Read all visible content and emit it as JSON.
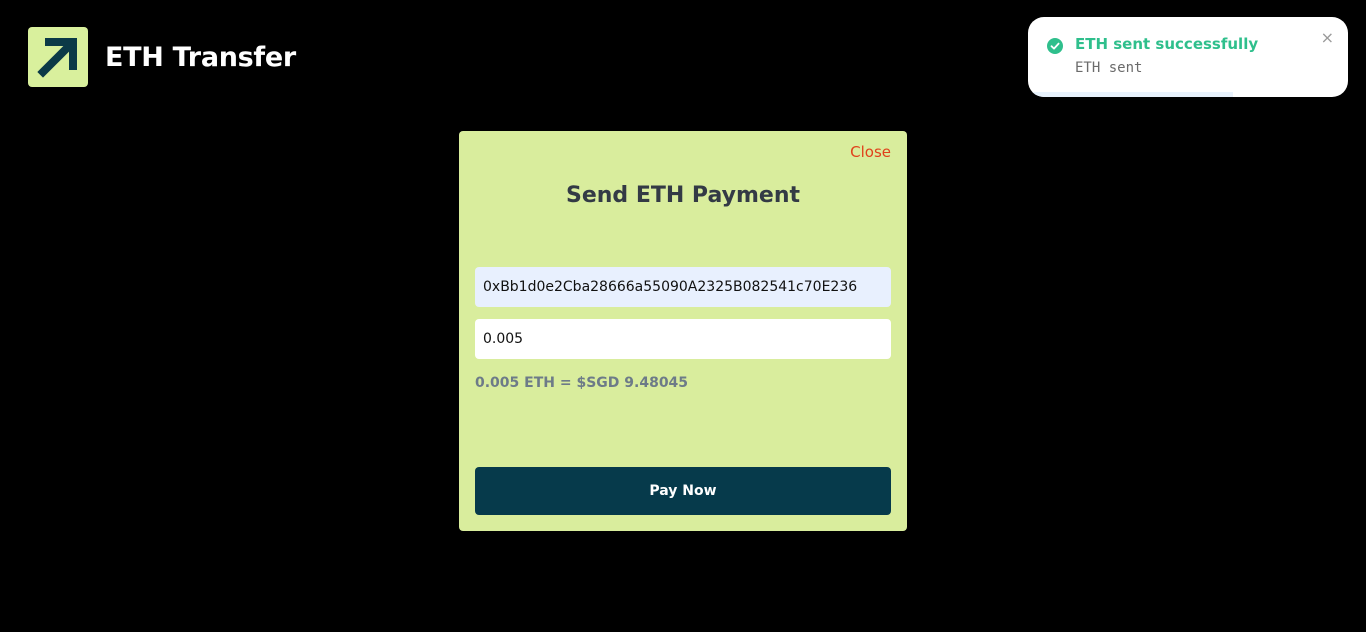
{
  "app": {
    "title": "ETH Transfer",
    "logo_icon": "arrow-up-right-icon",
    "logo_bg": "#d9f09d",
    "logo_fg": "#0b3a47"
  },
  "toast": {
    "title": "ETH sent successfully",
    "message": "ETH sent",
    "close_label": "×",
    "status_icon": "check-circle-icon",
    "status_color": "#2fbf8c",
    "progress": 0.64
  },
  "modal": {
    "close_label": "Close",
    "title": "Send ETH Payment",
    "address_value": "0xBb1d0e2Cba28666a55090A2325B082541c70E236",
    "amount_value": "0.005",
    "conversion_text": "0.005 ETH = $SGD 9.48045",
    "pay_label": "Pay Now",
    "background": "#d9ed9d",
    "button_color": "#063a4b",
    "close_color": "#e0411b"
  }
}
